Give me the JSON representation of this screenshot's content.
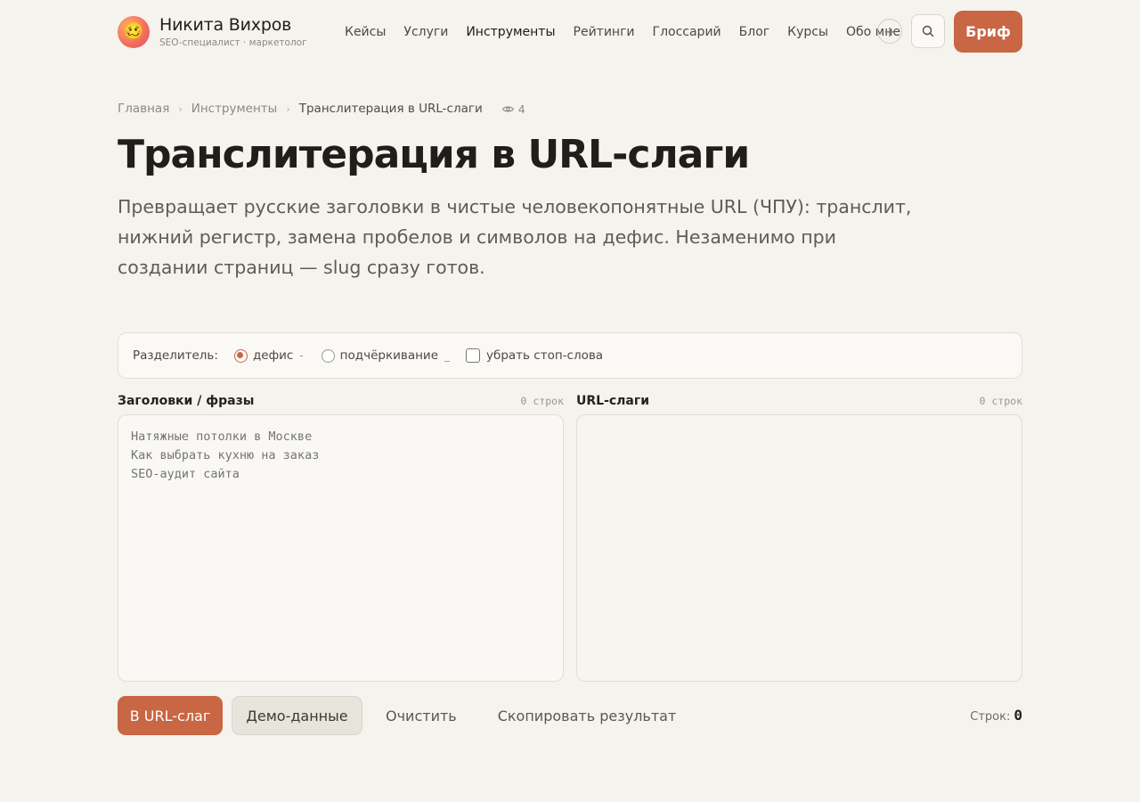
{
  "header": {
    "avatar_emoji": "🥴",
    "name": "Никита Вихров",
    "subtitle": "SEO-специалист · маркетолог",
    "nav": [
      {
        "label": "Кейсы",
        "active": false
      },
      {
        "label": "Услуги",
        "active": false
      },
      {
        "label": "Инструменты",
        "active": true
      },
      {
        "label": "Рейтинги",
        "active": false
      },
      {
        "label": "Глоссарий",
        "active": false
      },
      {
        "label": "Блог",
        "active": false
      },
      {
        "label": "Курсы",
        "active": false
      },
      {
        "label": "Обо мне",
        "active": false
      }
    ],
    "more_glyph": "+",
    "search_icon": "search-icon",
    "cta_label": "Бриф"
  },
  "breadcrumb": {
    "items": [
      "Главная",
      "Инструменты",
      "Транслитерация в URL-слаги"
    ],
    "separator": "›",
    "views_icon": "eye-icon",
    "views": "4"
  },
  "page": {
    "title": "Транслитерация в URL-слаги",
    "lead": "Превращает русские заголовки в чистые человекопонятные URL (ЧПУ): транслит, нижний регистр, замена пробелов и символов на дефис. Незаменимо при создании страниц — slug сразу готов."
  },
  "options": {
    "separator_label": "Разделитель:",
    "radios": [
      {
        "label": "дефис",
        "symbol": "-",
        "checked": true
      },
      {
        "label": "подчёркивание",
        "symbol": "_",
        "checked": false
      }
    ],
    "stopwords_label": "убрать стоп-слова",
    "stopwords_checked": false
  },
  "input_panel": {
    "title": "Заголовки / фразы",
    "count": "0 строк",
    "placeholder": "Натяжные потолки в Москве\nКак выбрать кухню на заказ\nSEO-аудит сайта",
    "value": ""
  },
  "output_panel": {
    "title": "URL-слаги",
    "count": "0 строк",
    "value": ""
  },
  "actions": {
    "convert": "В URL-слаг",
    "demo": "Демо-данные",
    "clear": "Очистить",
    "copy": "Скопировать результат"
  },
  "status": {
    "rows_label": "Строк:",
    "rows_value": "0"
  },
  "colors": {
    "accent": "#c96644",
    "background": "#f4f3ed"
  }
}
